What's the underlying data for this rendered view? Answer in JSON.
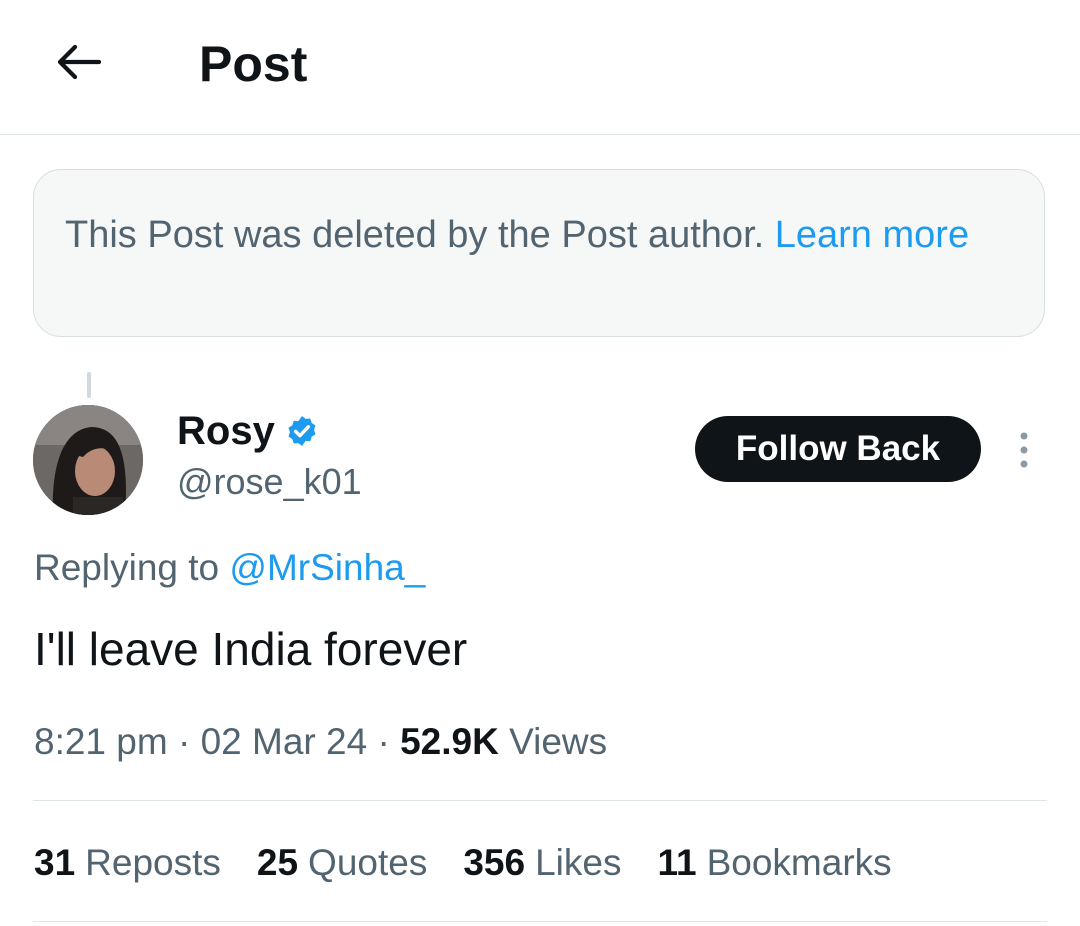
{
  "header": {
    "title": "Post",
    "back_icon": "arrow-left-icon"
  },
  "notice": {
    "text": "This Post was deleted by the Post author.",
    "link": "Learn more"
  },
  "author": {
    "name": "Rosy",
    "handle": "@rose_k01",
    "verified_icon": "verified-badge-icon",
    "verified_color": "#1d9bf0"
  },
  "follow_button": "Follow Back",
  "more_icon": "more-vertical-icon",
  "reply": {
    "prefix": "Replying to",
    "to": "@MrSinha_"
  },
  "post": {
    "text": "I'll leave India forever"
  },
  "meta": {
    "time": "8:21 pm",
    "sep": "·",
    "date": "02 Mar 24",
    "views_count": "52.9K",
    "views_label": "Views"
  },
  "stats": {
    "reposts": {
      "count": "31",
      "label": "Reposts"
    },
    "quotes": {
      "count": "25",
      "label": "Quotes"
    },
    "likes": {
      "count": "356",
      "label": "Likes"
    },
    "bookmarks": {
      "count": "11",
      "label": "Bookmarks"
    }
  },
  "colors": {
    "link": "#1d9bf0",
    "muted": "#536471",
    "text": "#0f1419"
  }
}
